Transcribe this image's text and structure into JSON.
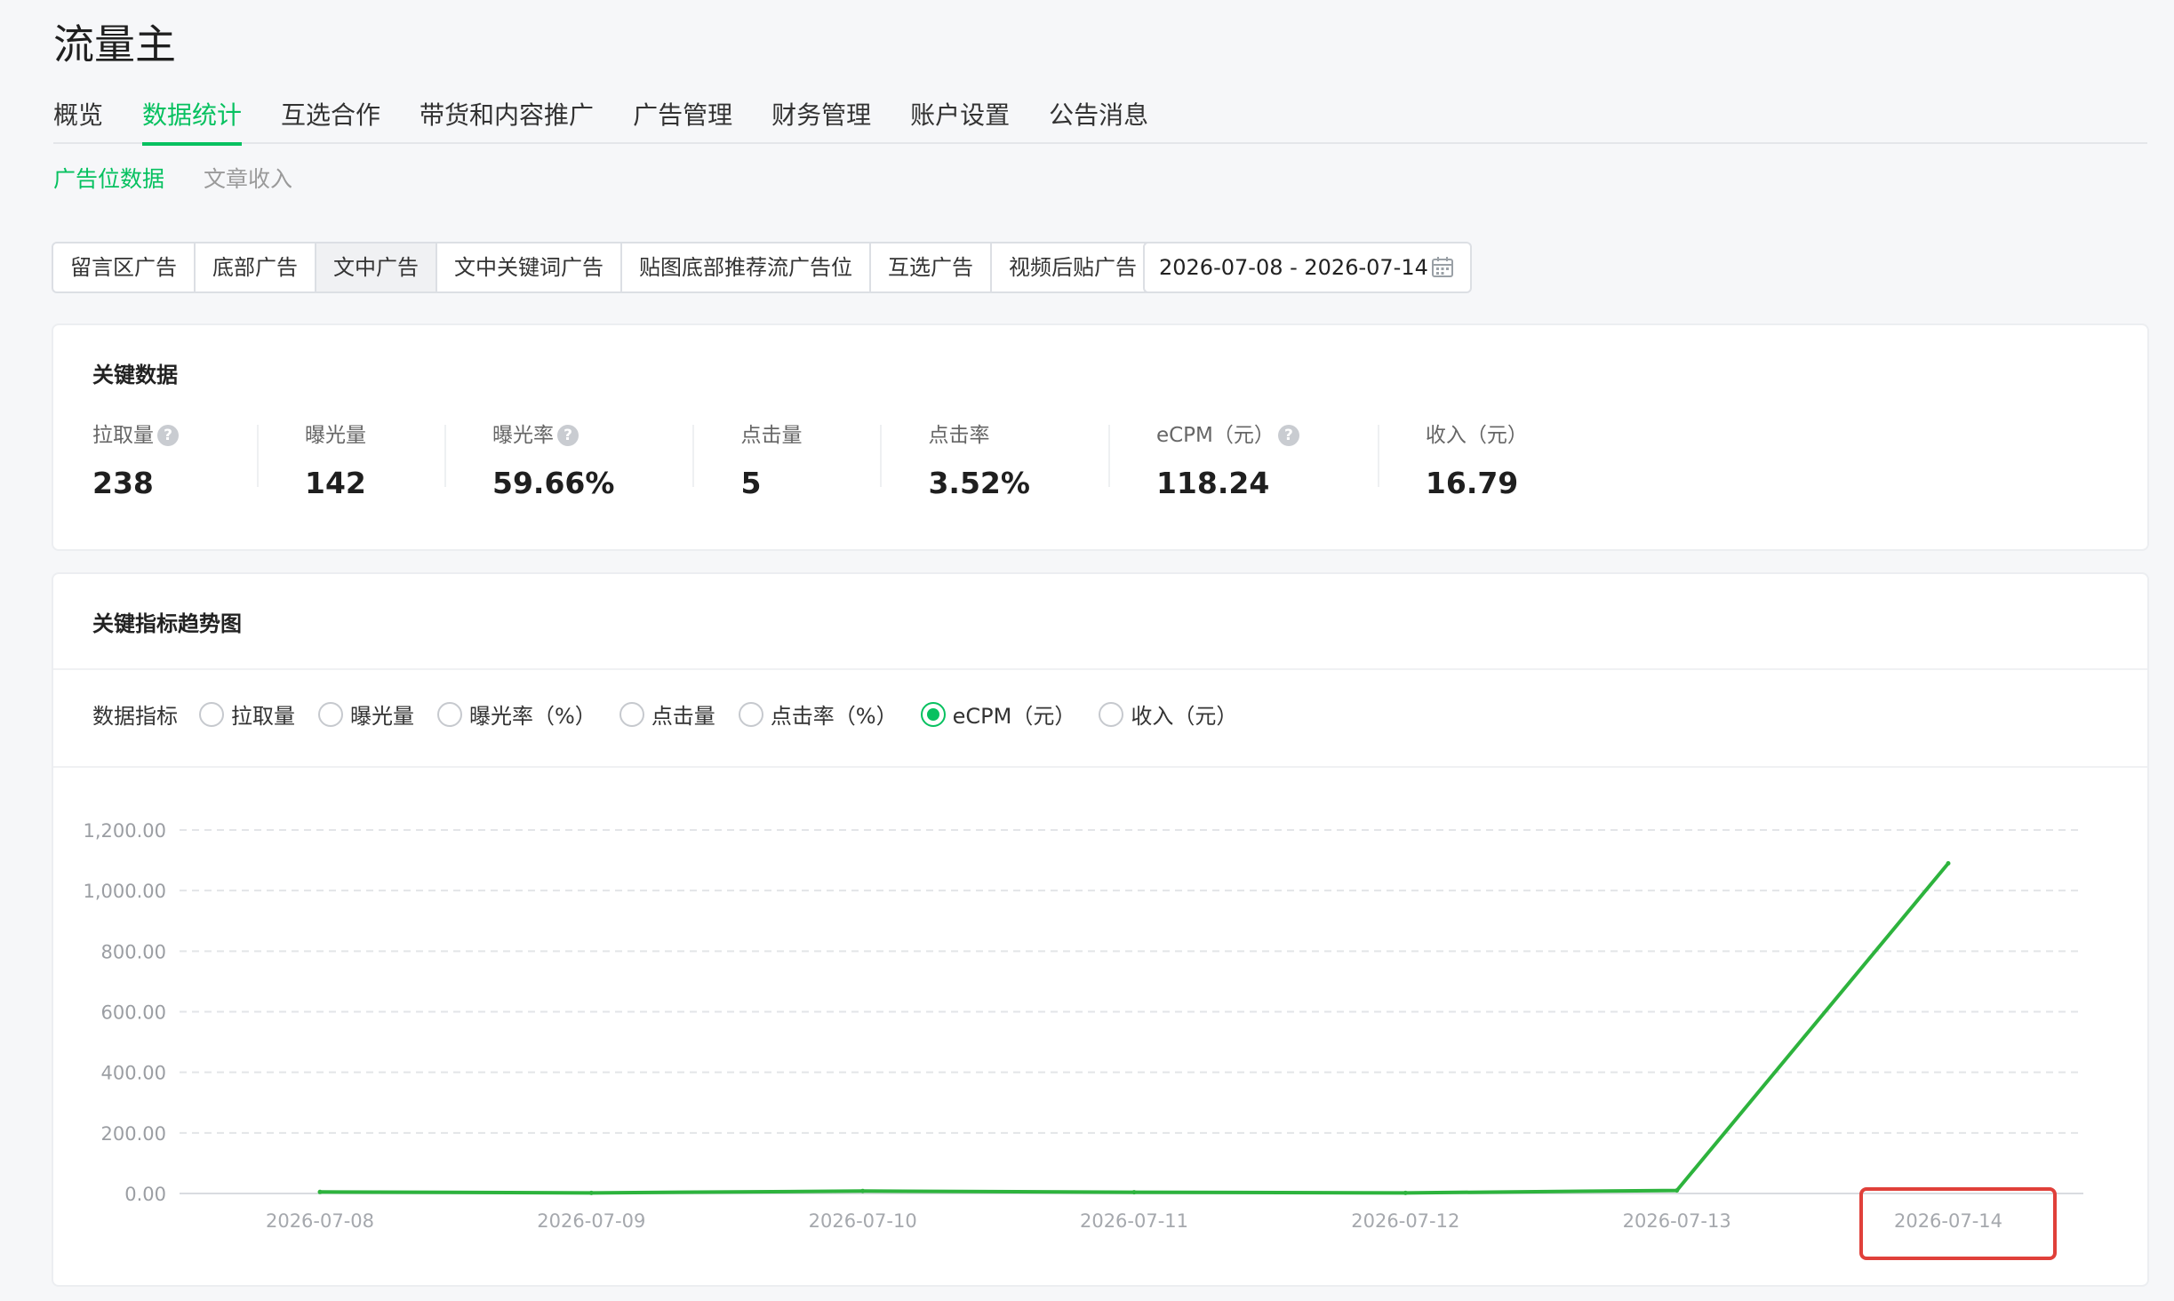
{
  "app": {
    "title": "流量主"
  },
  "main_nav": [
    {
      "label": "概览",
      "active": false
    },
    {
      "label": "数据统计",
      "active": true
    },
    {
      "label": "互选合作",
      "active": false
    },
    {
      "label": "带货和内容推广",
      "active": false
    },
    {
      "label": "广告管理",
      "active": false
    },
    {
      "label": "财务管理",
      "active": false
    },
    {
      "label": "账户设置",
      "active": false
    },
    {
      "label": "公告消息",
      "active": false
    }
  ],
  "sub_nav": [
    {
      "label": "广告位数据",
      "active": true
    },
    {
      "label": "文章收入",
      "active": false
    }
  ],
  "ad_tabs": [
    {
      "label": "留言区广告",
      "active": false
    },
    {
      "label": "底部广告",
      "active": false
    },
    {
      "label": "文中广告",
      "active": true
    },
    {
      "label": "文中关键词广告",
      "active": false
    },
    {
      "label": "贴图底部推荐流广告位",
      "active": false
    },
    {
      "label": "互选广告",
      "active": false
    },
    {
      "label": "视频后贴广告",
      "active": false
    }
  ],
  "date_range": {
    "value": "2026-07-08 - 2026-07-14",
    "icon": "calendar-icon"
  },
  "key_data": {
    "title": "关键数据",
    "metrics": [
      {
        "label": "拉取量",
        "value": "238",
        "help": true
      },
      {
        "label": "曝光量",
        "value": "142",
        "help": false
      },
      {
        "label": "曝光率",
        "value": "59.66%",
        "help": true
      },
      {
        "label": "点击量",
        "value": "5",
        "help": false
      },
      {
        "label": "点击率",
        "value": "3.52%",
        "help": false
      },
      {
        "label": "eCPM（元）",
        "value": "118.24",
        "help": true
      },
      {
        "label": "收入（元）",
        "value": "16.79",
        "help": false
      }
    ],
    "help_glyph": "?"
  },
  "trend": {
    "title": "关键指标趋势图",
    "indicator_label": "数据指标",
    "options": [
      {
        "label": "拉取量",
        "checked": false
      },
      {
        "label": "曝光量",
        "checked": false
      },
      {
        "label": "曝光率（%）",
        "checked": false
      },
      {
        "label": "点击量",
        "checked": false
      },
      {
        "label": "点击率（%）",
        "checked": false
      },
      {
        "label": "eCPM（元）",
        "checked": true
      },
      {
        "label": "收入（元）",
        "checked": false
      }
    ]
  },
  "chart_data": {
    "type": "line",
    "x": [
      "2026-07-08",
      "2026-07-09",
      "2026-07-10",
      "2026-07-11",
      "2026-07-12",
      "2026-07-13",
      "2026-07-14"
    ],
    "y_ticks": [
      "0.00",
      "200.00",
      "400.00",
      "600.00",
      "800.00",
      "1,000.00",
      "1,200.00"
    ],
    "ylim": [
      0,
      1200
    ],
    "series": [
      {
        "values": [
          5,
          2,
          8,
          4,
          2,
          10,
          1090
        ],
        "color": "#2db33d"
      }
    ],
    "grid": true,
    "highlighted_x": "2026-07-14"
  }
}
